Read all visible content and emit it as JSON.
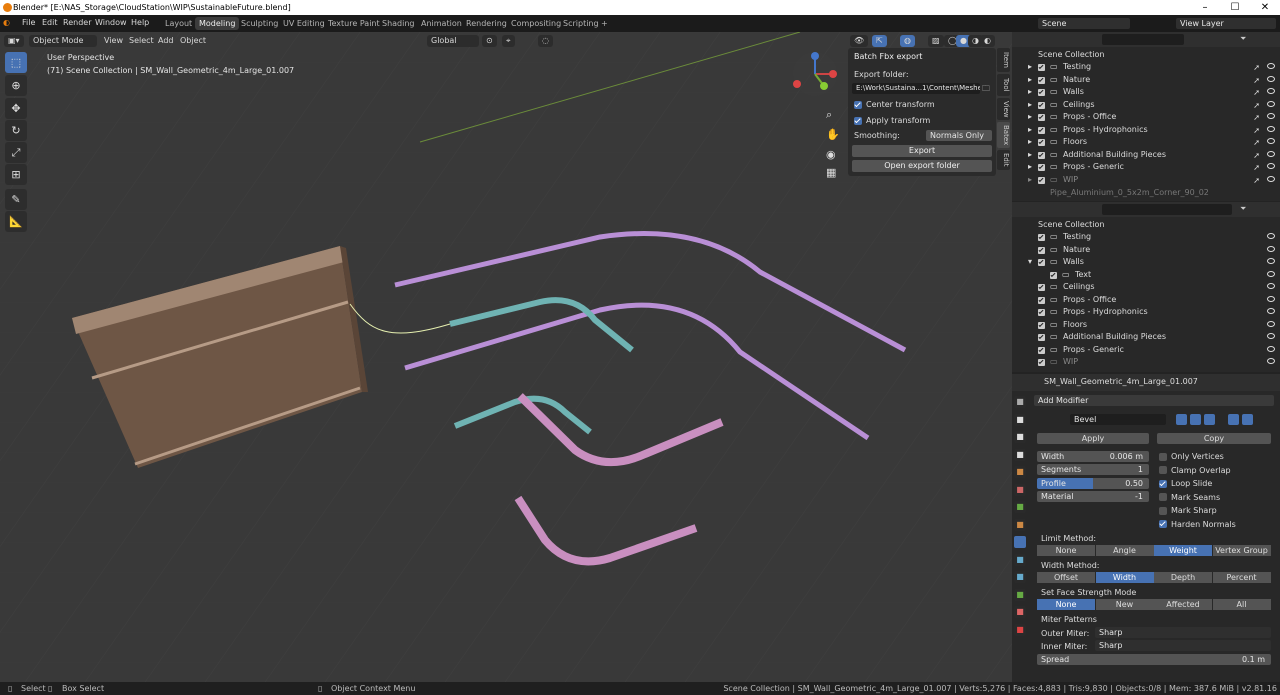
{
  "title": "Blender* [E:\\NAS_Storage\\CloudStation\\WIP\\SustainableFuture.blend]",
  "menu": [
    "File",
    "Edit",
    "Render",
    "Window",
    "Help"
  ],
  "workspaces": [
    "Layout",
    "Modeling",
    "Sculpting",
    "UV Editing",
    "Texture Paint",
    "Shading",
    "Animation",
    "Rendering",
    "Compositing",
    "Scripting"
  ],
  "scene": "Scene",
  "view_layer": "View Layer",
  "vp": {
    "mode": "Object Mode",
    "menus": [
      "View",
      "Select",
      "Add",
      "Object"
    ],
    "orientation": "Global",
    "persp": "User Perspective",
    "info": "(71) Scene Collection | SM_Wall_Geometric_4m_Large_01.007"
  },
  "batch": {
    "title": "Batch Fbx export",
    "folder_label": "Export folder:",
    "folder": "E:\\Work\\Sustaina...1\\Content\\Meshes\\",
    "center": "Center transform",
    "apply": "Apply transform",
    "smoothing_label": "Smoothing:",
    "smoothing": "Normals Only",
    "export": "Export",
    "open": "Open export folder"
  },
  "sidetabs": [
    "Item",
    "Tool",
    "View",
    "Batex",
    "Edit"
  ],
  "outliner1": {
    "root": "Scene Collection",
    "items": [
      "Testing",
      "Nature",
      "Walls",
      "Ceilings",
      "Props - Office",
      "Props - Hydrophonics",
      "Floors",
      "Additional Building Pieces",
      "Props - Generic",
      "WIP"
    ],
    "trail": "Pipe_Aluminium_0_5x2m_Corner_90_02"
  },
  "outliner2": {
    "root": "Scene Collection",
    "items": [
      "Testing",
      "Nature",
      "Walls",
      "Text",
      "Ceilings",
      "Props - Office",
      "Props - Hydrophonics",
      "Floors",
      "Additional Building Pieces",
      "Props - Generic",
      "WIP"
    ]
  },
  "props": {
    "object": "SM_Wall_Geometric_4m_Large_01.007",
    "add_modifier": "Add Modifier",
    "modifier": "Bevel",
    "apply": "Apply",
    "copy": "Copy",
    "width_label": "Width",
    "width": "0.006 m",
    "segments_label": "Segments",
    "segments": "1",
    "profile_label": "Profile",
    "profile": "0.50",
    "material_label": "Material",
    "material": "-1",
    "checks": [
      "Only Vertices",
      "Clamp Overlap",
      "Loop Slide",
      "Mark Seams",
      "Mark Sharp",
      "Harden Normals"
    ],
    "limit_label": "Limit Method:",
    "limit": [
      "None",
      "Angle",
      "Weight",
      "Vertex Group"
    ],
    "wmethod_label": "Width Method:",
    "wmethod": [
      "Offset",
      "Width",
      "Depth",
      "Percent"
    ],
    "face_label": "Set Face Strength Mode",
    "face": [
      "None",
      "New",
      "Affected",
      "All"
    ],
    "miter_label": "Miter Patterns",
    "outer_label": "Outer Miter:",
    "outer": "Sharp",
    "inner_label": "Inner Miter:",
    "inner": "Sharp",
    "spread_label": "Spread",
    "spread": "0.1 m"
  },
  "status": {
    "select": "Select",
    "box": "Box Select",
    "ctx": "Object Context Menu",
    "stats": "Scene Collection | SM_Wall_Geometric_4m_Large_01.007 | Verts:5,276 | Faces:4,883 | Tris:9,830 | Objects:0/8 | Mem: 387.6 MiB | v2.81.16"
  },
  "colors": {
    "accent": "#4772b3",
    "purple": "#b98fd6",
    "teal": "#6fb3b3",
    "pink": "#c98fc0",
    "wall": "#7d6450"
  }
}
